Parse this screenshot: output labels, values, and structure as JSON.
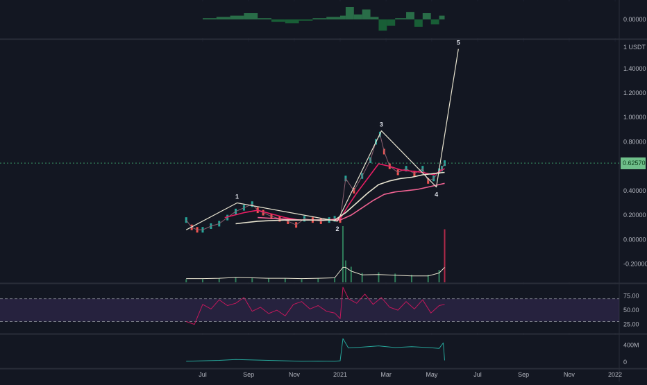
{
  "chart_data": {
    "type": "line",
    "symbol_unit": "1 USDT",
    "price_axis": {
      "ticks": [
        "1.40000",
        "1.20000",
        "1.00000",
        "0.80000",
        "0.40000",
        "0.20000",
        "0.00000",
        "-0.20000"
      ],
      "tick_values": [
        1.4,
        1.2,
        1.0,
        0.8,
        0.4,
        0.2,
        0.0,
        -0.2
      ],
      "range": [
        -0.35,
        1.62
      ],
      "current_price_label": "0.62570",
      "current_price": 0.6257
    },
    "x_axis": {
      "labels": [
        "Jul",
        "Sep",
        "Nov",
        "2021",
        "Mar",
        "May",
        "Jul",
        "Sep",
        "Nov",
        "2022"
      ],
      "label_times": [
        2020.5,
        2020.667,
        2020.833,
        2021.0,
        2021.167,
        2021.333,
        2021.5,
        2021.667,
        2021.833,
        2022.0
      ],
      "range": [
        2020.33,
        2022.05
      ]
    },
    "price_series": {
      "name": "Price",
      "x": [
        2020.44,
        2020.46,
        2020.48,
        2020.5,
        2020.53,
        2020.56,
        2020.59,
        2020.62,
        2020.65,
        2020.68,
        2020.7,
        2020.72,
        2020.75,
        2020.78,
        2020.81,
        2020.84,
        2020.87,
        2020.9,
        2020.93,
        2020.96,
        2020.98,
        2021.0,
        2021.02,
        2021.05,
        2021.08,
        2021.11,
        2021.13,
        2021.145,
        2021.16,
        2021.18,
        2021.21,
        2021.24,
        2021.27,
        2021.3,
        2021.32,
        2021.34,
        2021.36,
        2021.37,
        2021.38
      ],
      "y": [
        0.16,
        0.1,
        0.08,
        0.08,
        0.11,
        0.13,
        0.18,
        0.23,
        0.26,
        0.29,
        0.24,
        0.22,
        0.19,
        0.17,
        0.15,
        0.12,
        0.17,
        0.16,
        0.15,
        0.16,
        0.17,
        0.16,
        0.5,
        0.4,
        0.52,
        0.65,
        0.8,
        0.86,
        0.72,
        0.6,
        0.55,
        0.58,
        0.54,
        0.58,
        0.48,
        0.5,
        0.56,
        0.58,
        0.6257
      ]
    },
    "moving_averages": [
      {
        "color": "#e91e63",
        "x": [
          2020.58,
          2020.65,
          2020.7,
          2020.75,
          2020.8,
          2020.85,
          2020.9,
          2020.95,
          2021.0,
          2021.03,
          2021.06,
          2021.1,
          2021.14,
          2021.18,
          2021.22,
          2021.26,
          2021.3,
          2021.34,
          2021.38
        ],
        "y": [
          0.18,
          0.22,
          0.24,
          0.21,
          0.18,
          0.16,
          0.16,
          0.16,
          0.17,
          0.28,
          0.38,
          0.5,
          0.62,
          0.6,
          0.57,
          0.56,
          0.55,
          0.53,
          0.58
        ]
      },
      {
        "color": "#f06292",
        "x": [
          2020.7,
          2020.78,
          2020.86,
          2020.94,
          2021.0,
          2021.04,
          2021.08,
          2021.12,
          2021.16,
          2021.2,
          2021.24,
          2021.28,
          2021.32,
          2021.38
        ],
        "y": [
          0.18,
          0.17,
          0.16,
          0.16,
          0.16,
          0.2,
          0.26,
          0.32,
          0.37,
          0.39,
          0.4,
          0.41,
          0.43,
          0.46
        ]
      },
      {
        "color": "#e8e4d0",
        "x": [
          2020.62,
          2020.7,
          2020.8,
          2020.9,
          2020.98,
          2021.02,
          2021.06,
          2021.1,
          2021.14,
          2021.18,
          2021.22,
          2021.26,
          2021.3,
          2021.34,
          2021.38
        ],
        "y": [
          0.13,
          0.15,
          0.16,
          0.16,
          0.16,
          0.22,
          0.3,
          0.38,
          0.45,
          0.48,
          0.5,
          0.51,
          0.53,
          0.54,
          0.55
        ]
      }
    ],
    "elliott_wave": {
      "labels": [
        "1",
        "2",
        "3",
        "4",
        "5"
      ],
      "x": [
        2020.44,
        2020.625,
        2020.99,
        2021.15,
        2021.35,
        2021.43
      ],
      "y": [
        0.08,
        0.3,
        0.15,
        0.89,
        0.43,
        1.56
      ]
    },
    "volume": {
      "x": [
        2020.44,
        2020.5,
        2020.56,
        2020.62,
        2020.68,
        2020.74,
        2020.8,
        2020.86,
        2020.92,
        2020.98,
        2021.01,
        2021.02,
        2021.04,
        2021.08,
        2021.14,
        2021.2,
        2021.26,
        2021.32,
        2021.36,
        2021.38
      ],
      "y": [
        0.05,
        0.05,
        0.06,
        0.08,
        0.07,
        0.06,
        0.06,
        0.05,
        0.06,
        0.07,
        0.9,
        0.35,
        0.25,
        0.15,
        0.16,
        0.14,
        0.12,
        0.12,
        0.2,
        0.85
      ]
    },
    "top_oscillator": {
      "zero_label": "0.00000",
      "x": [
        2020.5,
        2020.55,
        2020.6,
        2020.65,
        2020.7,
        2020.75,
        2020.8,
        2020.85,
        2020.9,
        2020.95,
        2021.0,
        2021.02,
        2021.05,
        2021.08,
        2021.11,
        2021.14,
        2021.17,
        2021.2,
        2021.24,
        2021.27,
        2021.3,
        2021.33,
        2021.36,
        2021.38
      ],
      "y": [
        0.1,
        0.2,
        0.3,
        0.5,
        0.1,
        -0.2,
        -0.3,
        -0.1,
        0.1,
        0.2,
        0.3,
        1.0,
        0.4,
        0.8,
        0.2,
        -0.9,
        -0.5,
        0.1,
        0.6,
        -0.6,
        0.5,
        -0.4,
        0.3,
        0.5
      ]
    },
    "rsi": {
      "ticks": [
        "75.00",
        "50.00",
        "25.00"
      ],
      "tick_values": [
        75,
        50,
        25
      ],
      "upper_band": 70,
      "lower_band": 30,
      "x": [
        2020.44,
        2020.47,
        2020.5,
        2020.53,
        2020.56,
        2020.59,
        2020.62,
        2020.65,
        2020.68,
        2020.71,
        2020.74,
        2020.77,
        2020.8,
        2020.83,
        2020.86,
        2020.89,
        2020.92,
        2020.95,
        2020.98,
        2021.0,
        2021.01,
        2021.03,
        2021.06,
        2021.09,
        2021.12,
        2021.15,
        2021.18,
        2021.21,
        2021.24,
        2021.27,
        2021.3,
        2021.33,
        2021.36,
        2021.38
      ],
      "y": [
        30,
        25,
        60,
        52,
        68,
        58,
        62,
        72,
        48,
        55,
        44,
        50,
        40,
        60,
        65,
        52,
        58,
        48,
        45,
        35,
        90,
        70,
        62,
        78,
        60,
        72,
        55,
        50,
        65,
        52,
        68,
        45,
        58,
        60
      ]
    },
    "volume_line": {
      "ticks": [
        "400M",
        "0"
      ],
      "tick_values": [
        400,
        0
      ],
      "x": [
        2020.44,
        2020.5,
        2020.56,
        2020.62,
        2020.68,
        2020.74,
        2020.8,
        2020.86,
        2020.92,
        2020.98,
        2021.0,
        2021.01,
        2021.03,
        2021.08,
        2021.14,
        2021.2,
        2021.26,
        2021.32,
        2021.36,
        2021.375,
        2021.38
      ],
      "y": [
        20,
        30,
        40,
        60,
        50,
        40,
        30,
        20,
        25,
        20,
        30,
        550,
        330,
        350,
        380,
        340,
        360,
        340,
        320,
        450,
        40
      ]
    }
  }
}
